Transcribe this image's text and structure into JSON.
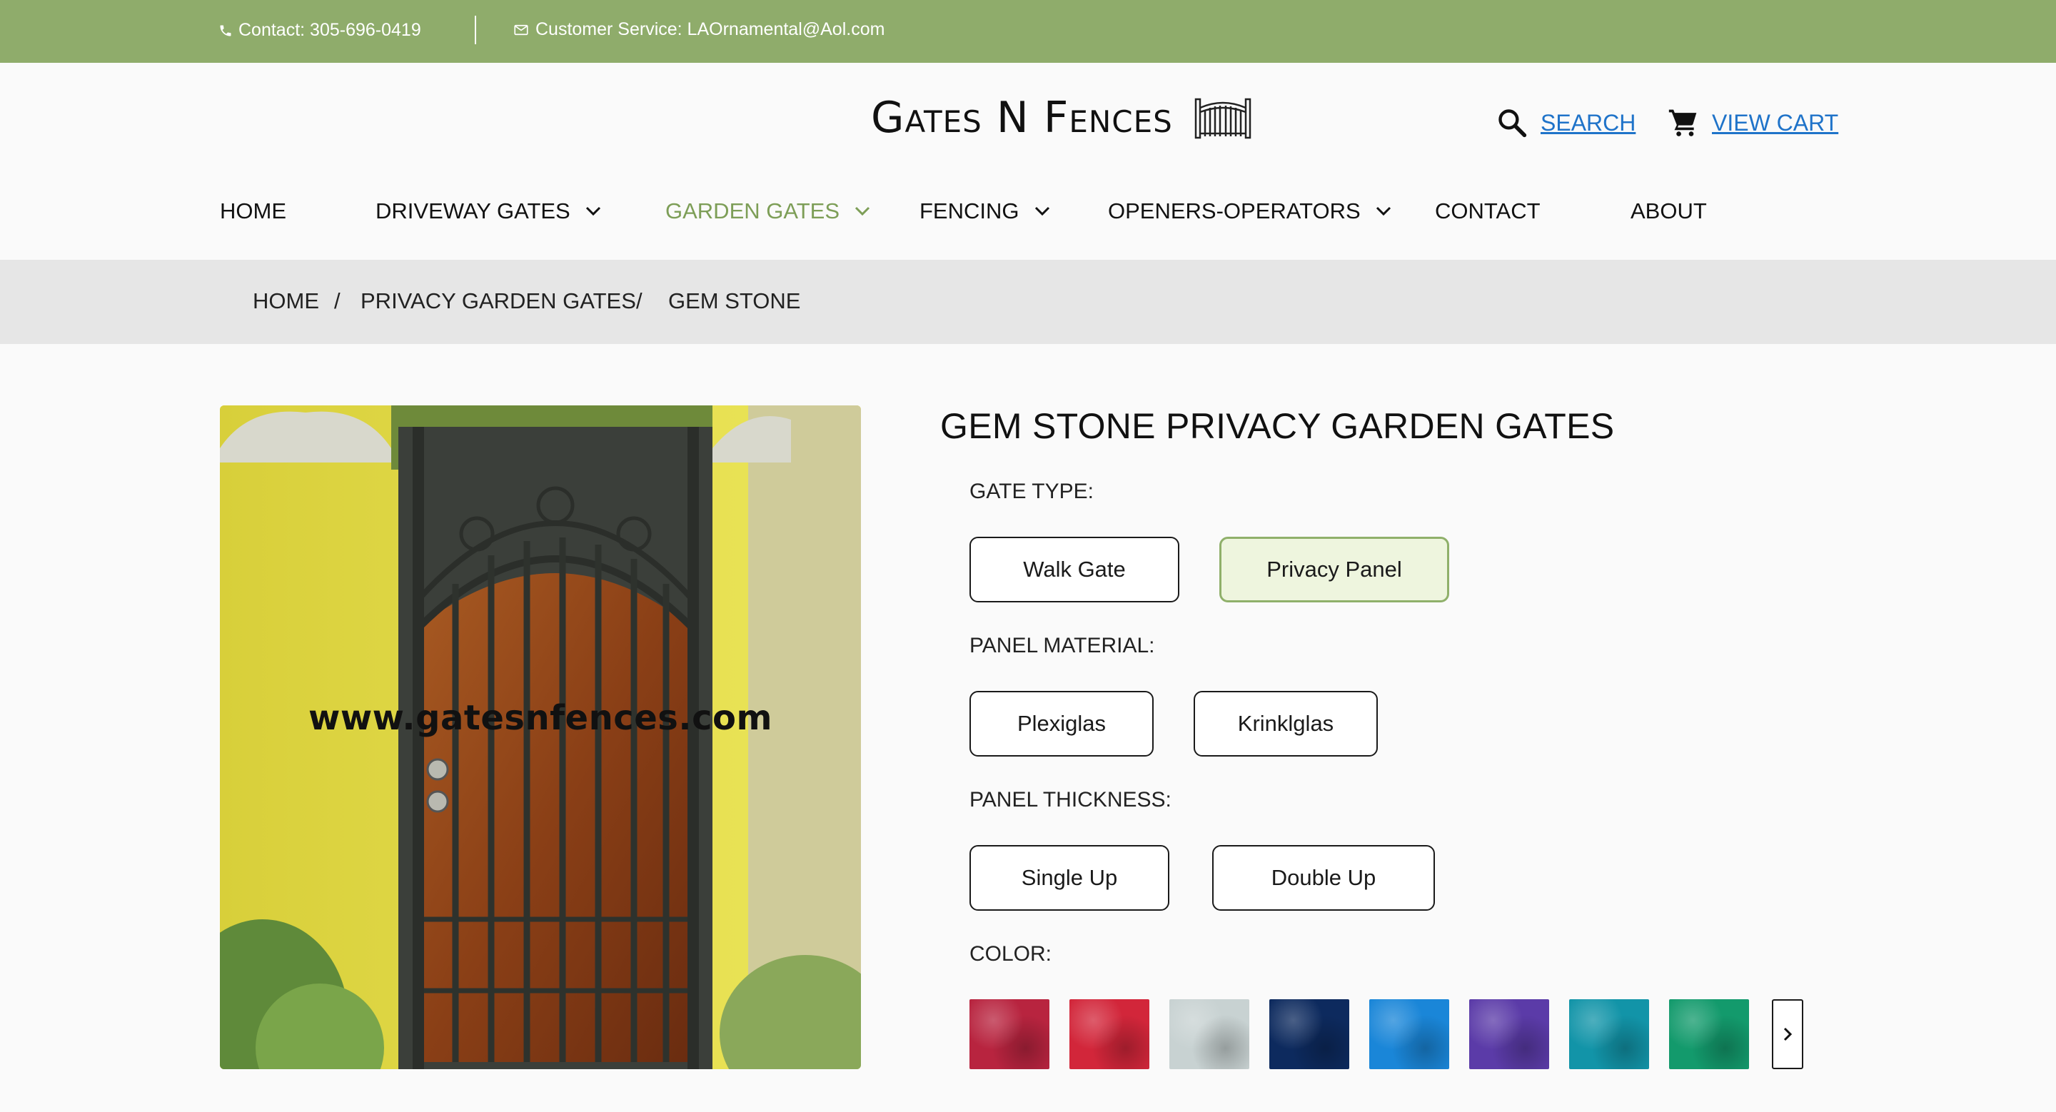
{
  "topbar": {
    "contact": "Contact: 305-696-0419",
    "service": "Customer Service: LAOrnamental@Aol.com"
  },
  "header": {
    "logo_text": "Gates N Fences",
    "search_label": "SEARCH",
    "cart_label": "VIEW CART"
  },
  "nav": {
    "items": [
      {
        "label": "HOME"
      },
      {
        "label": "DRIVEWAY GATES"
      },
      {
        "label": "GARDEN GATES"
      },
      {
        "label": "FENCING"
      },
      {
        "label": "OPENERS-OPERATORS"
      },
      {
        "label": "CONTACT"
      },
      {
        "label": "ABOUT"
      }
    ],
    "active": "GARDEN GATES"
  },
  "breadcrumb": {
    "items": [
      "HOME",
      "PRIVACY GARDEN GATES",
      "GEM STONE"
    ],
    "separator": "/"
  },
  "product": {
    "watermark": "www.gatesnfences.com",
    "title": "GEM STONE PRIVACY GARDEN GATES",
    "gate_type": {
      "label": "GATE TYPE:",
      "options": [
        "Walk Gate",
        "Privacy Panel"
      ],
      "selected": "Privacy Panel"
    },
    "panel_material": {
      "label": "PANEL MATERIAL:",
      "options": [
        "Plexiglas",
        "Krinklglas"
      ]
    },
    "panel_thickness": {
      "label": "PANEL THICKNESS:",
      "options": [
        "Single Up",
        "Double Up"
      ]
    },
    "color": {
      "label": "COLOR:",
      "swatches": [
        "#b8243f",
        "#d2263a",
        "#c8d2d2",
        "#0d2a5e",
        "#1a86d8",
        "#5b3ba8",
        "#1294a8",
        "#139a6c"
      ]
    }
  },
  "colors": {
    "topbar": "#8fac6b",
    "accent": "#7d9e57",
    "link": "#1f73c9",
    "breadcrumb_bg": "#e6e6e6",
    "selected_bg": "#eef5de"
  }
}
